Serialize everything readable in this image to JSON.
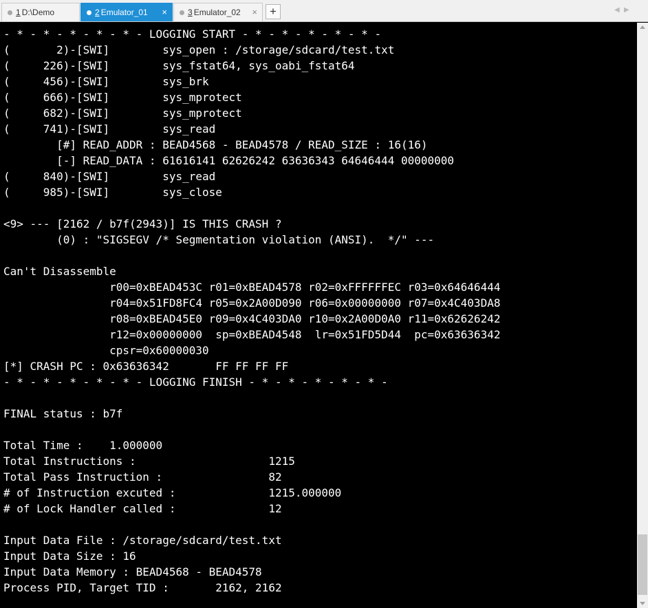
{
  "tabs": [
    {
      "num": "1",
      "label": "D:\\Demo",
      "active": false
    },
    {
      "num": "2",
      "label": "Emulator_01",
      "active": true
    },
    {
      "num": "3",
      "label": "Emulator_02",
      "active": false
    }
  ],
  "add_tab_label": "+",
  "close_glyph": "×",
  "nav": {
    "left": "◀",
    "right": "▶"
  },
  "colors": {
    "tab_active": "#1f8fd6",
    "console_bg": "#000000",
    "console_text": "#ffffff"
  },
  "console_lines": [
    "- * - * - * - * - * - LOGGING START - * - * - * - * - * -",
    "(       2)-[SWI]        sys_open : /storage/sdcard/test.txt",
    "(     226)-[SWI]        sys_fstat64, sys_oabi_fstat64",
    "(     456)-[SWI]        sys_brk",
    "(     666)-[SWI]        sys_mprotect",
    "(     682)-[SWI]        sys_mprotect",
    "(     741)-[SWI]        sys_read",
    "        [#] READ_ADDR : BEAD4568 - BEAD4578 / READ_SIZE : 16(16)",
    "        [-] READ_DATA : 61616141 62626242 63636343 64646444 00000000",
    "(     840)-[SWI]        sys_read",
    "(     985)-[SWI]        sys_close",
    "",
    "<9> --- [2162 / b7f(2943)] IS THIS CRASH ?",
    "        (0) : \"SIGSEGV /* Segmentation violation (ANSI).  */\" ---",
    "",
    "Can't Disassemble",
    "                r00=0xBEAD453C r01=0xBEAD4578 r02=0xFFFFFFEC r03=0x64646444",
    "                r04=0x51FD8FC4 r05=0x2A00D090 r06=0x00000000 r07=0x4C403DA8",
    "                r08=0xBEAD45E0 r09=0x4C403DA0 r10=0x2A00D0A0 r11=0x62626242",
    "                r12=0x00000000  sp=0xBEAD4548  lr=0x51FD5D44  pc=0x63636342",
    "                cpsr=0x60000030",
    "[*] CRASH PC : 0x63636342       FF FF FF FF",
    "- * - * - * - * - * - LOGGING FINISH - * - * - * - * - * -",
    "",
    "FINAL status : b7f",
    "",
    "Total Time :    1.000000",
    "Total Instructions :                    1215",
    "Total Pass Instruction :                82",
    "# of Instruction excuted :              1215.000000",
    "# of Lock Handler called :              12",
    "",
    "Input Data File : /storage/sdcard/test.txt",
    "Input Data Size : 16",
    "Input Data Memory : BEAD4568 - BEAD4578",
    "Process PID, Target TID :       2162, 2162"
  ]
}
